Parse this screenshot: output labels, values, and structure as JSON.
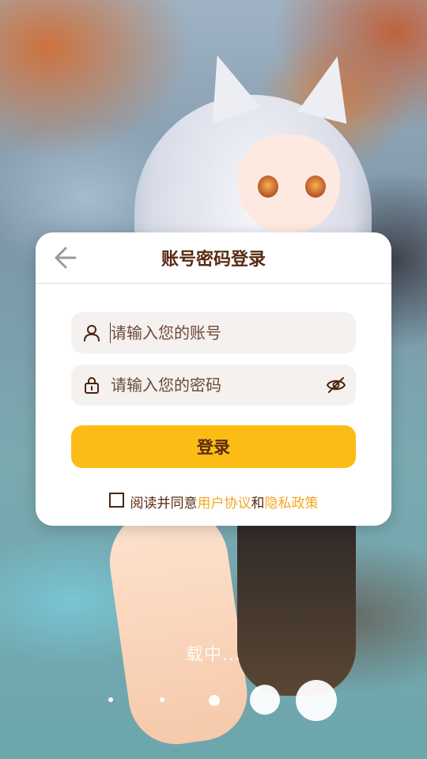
{
  "header": {
    "title": "账号密码登录",
    "back_icon": "arrow-left-icon"
  },
  "form": {
    "account_placeholder": "请输入您的账号",
    "password_placeholder": "请输入您的密码",
    "account_icon": "user-icon",
    "password_icon": "lock-icon",
    "visibility_icon": "eye-off-icon"
  },
  "login_button": "登录",
  "agreement": {
    "prefix": "阅读并同意",
    "user_agreement": "用户协议",
    "and": "和",
    "privacy_policy": "隐私政策"
  },
  "loading_text": "载中...",
  "colors": {
    "accent": "#fbbc16",
    "title_text": "#5a2a12",
    "link": "#f5a623",
    "field_bg": "#f5f1ee"
  }
}
